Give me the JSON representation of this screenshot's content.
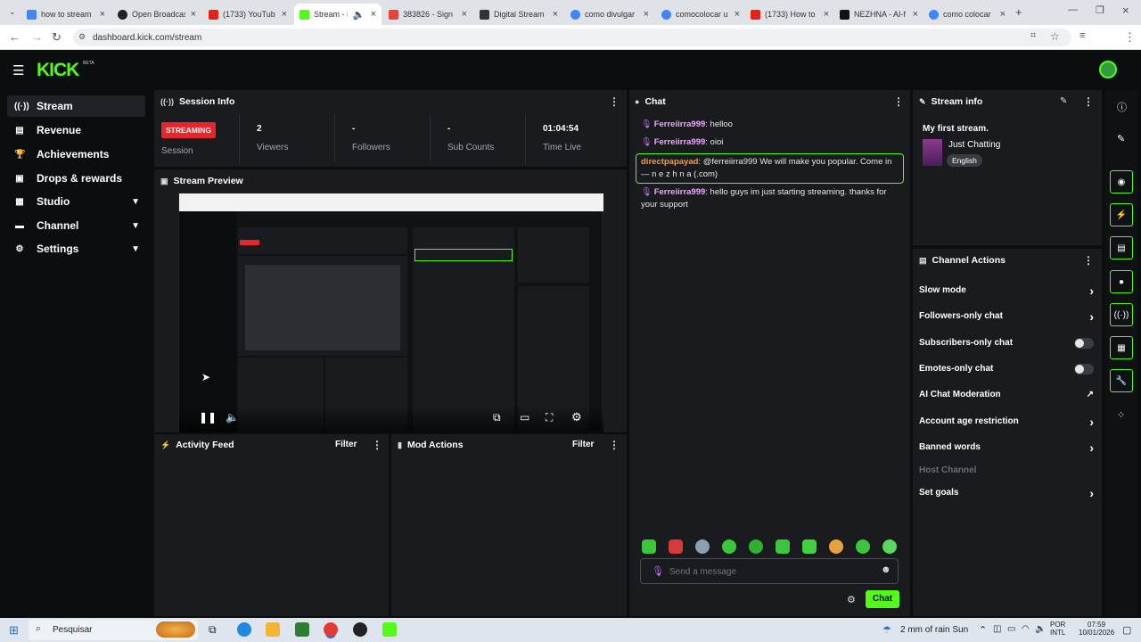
{
  "browser": {
    "tabs": [
      {
        "label": "how to stream",
        "color": "#4285f4"
      },
      {
        "label": "Open Broadcas",
        "color": "#222"
      },
      {
        "label": "(1733) YouTub",
        "color": "#e62117"
      },
      {
        "label": "Stream - K",
        "color": "#53fc18"
      },
      {
        "label": "383826 - Sign",
        "color": "#ea4335"
      },
      {
        "label": "Digital Stream",
        "color": "#333"
      },
      {
        "label": "como divulgar",
        "color": "#4285f4"
      },
      {
        "label": "comocolocar u",
        "color": "#4285f4"
      },
      {
        "label": "(1733) How to",
        "color": "#e62117"
      },
      {
        "label": "NEZHNA - AI-f",
        "color": "#111"
      },
      {
        "label": "como colocar",
        "color": "#4285f4"
      }
    ],
    "url": "dashboard.kick.com/stream"
  },
  "brand": {
    "logo": "KICK",
    "beta": "BETA",
    "accent": "#53fc18"
  },
  "sidebar": {
    "items": [
      {
        "label": "Stream",
        "icon": "broadcast-icon"
      },
      {
        "label": "Revenue",
        "icon": "wallet-icon"
      },
      {
        "label": "Achievements",
        "icon": "trophy-icon"
      },
      {
        "label": "Drops & rewards",
        "icon": "gift-icon"
      },
      {
        "label": "Studio",
        "icon": "studio-icon"
      },
      {
        "label": "Channel",
        "icon": "channel-icon"
      },
      {
        "label": "Settings",
        "icon": "gear-icon"
      }
    ]
  },
  "session": {
    "title": "Session Info",
    "badge": "STREAMING",
    "session_label": "Session",
    "stats": [
      {
        "value": "2",
        "label": "Viewers"
      },
      {
        "value": "-",
        "label": "Followers"
      },
      {
        "value": "-",
        "label": "Sub Counts"
      },
      {
        "value": "01:04:54",
        "label": "Time Live"
      }
    ]
  },
  "preview": {
    "title": "Stream Preview"
  },
  "activity": {
    "title": "Activity Feed",
    "filter": "Filter"
  },
  "mod": {
    "title": "Mod Actions",
    "filter": "Filter"
  },
  "chat": {
    "title": "Chat",
    "messages": [
      {
        "user": "Ferreiirra999",
        "text": ": helloo"
      },
      {
        "user": "Ferreiirra999",
        "text": ": oioi"
      },
      {
        "user": "directpapayad",
        "text": ": @ferreiirra999 We will make you popular. Come in — n e z h n a (.com)"
      },
      {
        "user": "Ferreiirra999",
        "text": ": hello guys im just starting streaming. thanks for your support"
      }
    ],
    "placeholder": "Send a message",
    "send": "Chat"
  },
  "stream_info": {
    "title": "Stream info",
    "stream_title": "My first stream.",
    "category": "Just Chatting",
    "language": "English"
  },
  "channel_actions": {
    "title": "Channel Actions",
    "items": [
      {
        "label": "Slow mode",
        "control": "arrow"
      },
      {
        "label": "Followers-only chat",
        "control": "arrow"
      },
      {
        "label": "Subscribers-only chat",
        "control": "toggle"
      },
      {
        "label": "Emotes-only chat",
        "control": "toggle"
      },
      {
        "label": "AI Chat Moderation",
        "control": "external"
      },
      {
        "label": "Account age restriction",
        "control": "arrow"
      },
      {
        "label": "Banned words",
        "control": "arrow"
      },
      {
        "label": "Host Channel",
        "control": "none"
      },
      {
        "label": "Set goals",
        "control": "arrow"
      }
    ]
  },
  "taskbar": {
    "search": "Pesquisar",
    "weather": "2 mm of rain Sun",
    "lang": "POR",
    "lang2": "INTL",
    "time": "07:59",
    "date": "10/01/2026"
  }
}
